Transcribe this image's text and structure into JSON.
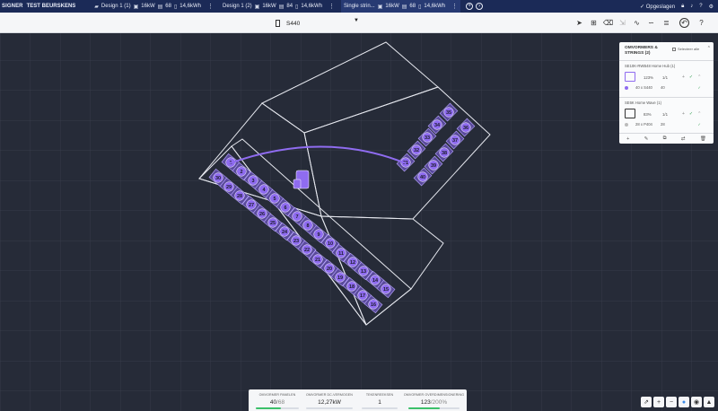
{
  "topbar": {
    "brand": "SIGNER",
    "project": "TEST BEURSKENS",
    "tabs": [
      {
        "name": "Design 1 (1)",
        "power": "16kW",
        "panels": "68",
        "battery": "14,6kWh"
      },
      {
        "name": "Design 1 (2)",
        "power": "16kW",
        "panels": "84",
        "battery": "14,6kWh"
      },
      {
        "name": "Single strin...",
        "power": "16kW",
        "panels": "68",
        "battery": "14,6kWh"
      }
    ],
    "saved_label": "Opgeslagen",
    "icons": [
      "add-tab-icon",
      "next-tab-icon",
      "bell-icon",
      "lock-icon",
      "help-icon",
      "settings-icon"
    ]
  },
  "toolbar": {
    "panel_model": "S440",
    "tools": [
      "select-pointer-icon",
      "add-panel-icon",
      "erase-icon",
      "align-icon",
      "stringing-icon",
      "auto-string-icon",
      "rows-icon",
      "undo-icon"
    ]
  },
  "sidepanel": {
    "title_line1": "OMVORMERS &",
    "title_line2": "STRINGS (2)",
    "select_all": "Selecteer alle",
    "inverters": [
      {
        "name": "SE10K-RWB48 Home Hub (1)",
        "ratio": "123%",
        "count": "1/1",
        "string_modules": "40 x S440",
        "string_count": "40",
        "dot_color": "#8f6cf0",
        "active": true
      },
      {
        "name": "SE6K Home Wave (1)",
        "ratio": "83%",
        "count": "1/1",
        "string_modules": "28 x P404",
        "string_count": "28",
        "dot_color": "#bbbbbb",
        "active": false
      }
    ],
    "footer_icons": [
      "add-icon",
      "edit-icon",
      "duplicate-icon",
      "swap-icon",
      "delete-icon"
    ]
  },
  "stats": [
    {
      "label": "OMVORMER PANELEN",
      "value": "40",
      "suffix": "/68",
      "progress": 0.59
    },
    {
      "label": "OMVORMER DC-VERMOGEN",
      "value": "12,27kW",
      "suffix": "",
      "progress": null
    },
    {
      "label": "TEKENREEKSEN",
      "value": "1",
      "suffix": "",
      "progress": null
    },
    {
      "label": "OMVORMER OVERDIMENSIONERING",
      "value": "123",
      "suffix": "/200%",
      "progress": 0.62
    }
  ],
  "map_controls": [
    "share-icon",
    "zoom-in-icon",
    "zoom-out-icon",
    "satellite-icon",
    "layers-icon",
    "compass-icon"
  ],
  "roof": {
    "panel_numbers_left": [
      30,
      29,
      28,
      27,
      26,
      25,
      24,
      23,
      22,
      21,
      20,
      19,
      18,
      17,
      16,
      1,
      2,
      3,
      4,
      5,
      6,
      7,
      8,
      9,
      10,
      11,
      12,
      13,
      14,
      15
    ],
    "panel_numbers_right": [
      35,
      34,
      33,
      32,
      31,
      36,
      37,
      38,
      39,
      40
    ],
    "string_color": "#8f6cf0"
  }
}
